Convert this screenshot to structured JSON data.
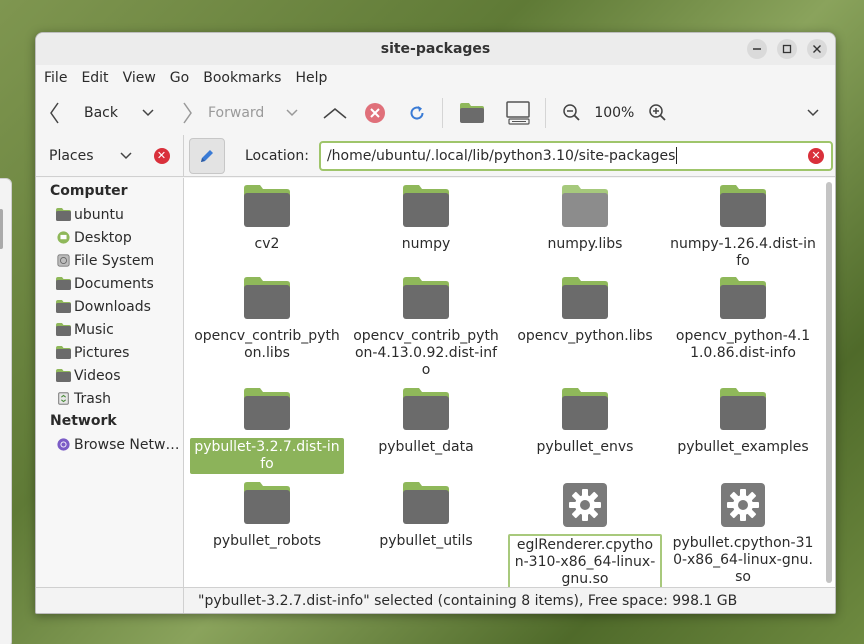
{
  "window": {
    "title": "site-packages"
  },
  "menu": [
    "File",
    "Edit",
    "View",
    "Go",
    "Bookmarks",
    "Help"
  ],
  "toolbar": {
    "back_label": "Back",
    "forward_label": "Forward",
    "zoom_level": "100%"
  },
  "location": {
    "places_label": "Places",
    "label": "Location:",
    "path": "/home/ubuntu/.local/lib/python3.10/site-packages"
  },
  "sidebar": {
    "computer_header": "Computer",
    "computer_items": [
      {
        "label": "ubuntu",
        "icon": "folder-icon"
      },
      {
        "label": "Desktop",
        "icon": "desktop-icon"
      },
      {
        "label": "File System",
        "icon": "drive-icon"
      },
      {
        "label": "Documents",
        "icon": "folder-icon"
      },
      {
        "label": "Downloads",
        "icon": "folder-icon"
      },
      {
        "label": "Music",
        "icon": "folder-icon"
      },
      {
        "label": "Pictures",
        "icon": "folder-icon"
      },
      {
        "label": "Videos",
        "icon": "folder-icon"
      },
      {
        "label": "Trash",
        "icon": "trash-icon"
      }
    ],
    "network_header": "Network",
    "network_items": [
      {
        "label": "Browse Netw…",
        "icon": "network-icon"
      }
    ]
  },
  "files": [
    {
      "name": "cv2",
      "type": "folder"
    },
    {
      "name": "numpy",
      "type": "folder"
    },
    {
      "name": "numpy.libs",
      "type": "folder-light"
    },
    {
      "name": "numpy-1.26.4.dist-info",
      "type": "folder"
    },
    {
      "name": "opencv_contrib_python.libs",
      "type": "folder"
    },
    {
      "name": "opencv_contrib_python-4.13.0.92.dist-info",
      "type": "folder"
    },
    {
      "name": "opencv_python.libs",
      "type": "folder"
    },
    {
      "name": "opencv_python-4.11.0.86.dist-info",
      "type": "folder"
    },
    {
      "name": "pybullet-3.2.7.dist-info",
      "type": "folder",
      "selected": true
    },
    {
      "name": "pybullet_data",
      "type": "folder"
    },
    {
      "name": "pybullet_envs",
      "type": "folder"
    },
    {
      "name": "pybullet_examples",
      "type": "folder"
    },
    {
      "name": "pybullet_robots",
      "type": "folder"
    },
    {
      "name": "pybullet_utils",
      "type": "folder"
    },
    {
      "name": "eglRenderer.cpython-310-x86_64-linux-gnu.so",
      "type": "library",
      "focused": true
    },
    {
      "name": "pybullet.cpython-310-x86_64-linux-gnu.so",
      "type": "library"
    }
  ],
  "status": "\"pybullet-3.2.7.dist-info\" selected (containing 8 items), Free space: 998.1 GB",
  "colors": {
    "accent": "#8cb35a",
    "folder_tab": "#8fb85a",
    "folder_body": "#6b6b6b",
    "close_red": "#d9303b"
  }
}
